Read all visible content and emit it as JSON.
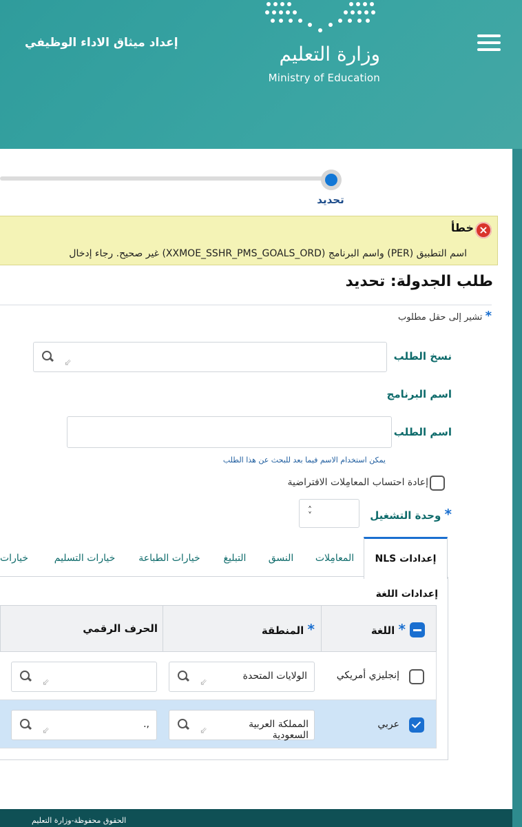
{
  "header": {
    "app_title": "إعداد ميثاق الاداء الوظيفي",
    "logo_arabic": "وزارة التعليم",
    "logo_english": "Ministry of Education",
    "menu_icon": "hamburger-icon"
  },
  "train": {
    "step_label": "تحديد"
  },
  "error": {
    "title": "خطأ",
    "message": "اسم التطبيق (PER) واسم البرنامج (XXMOE_SSHR_PMS_GOALS_ORD) غير صحيح. رجاء إدخال",
    "icon": "error-icon"
  },
  "page": {
    "title": "طلب الجدولة: تحديد",
    "required_note": "تشير إلى حقل مطلوب",
    "required_star": "*"
  },
  "form": {
    "copy_request_label": "نسخ الطلب",
    "program_name_label": "اسم البرنامج",
    "request_name_label": "اسم الطلب",
    "request_name_hint": "يمكن استخدام الاسم فيما بعد للبحث عن هذا الطلب",
    "recalc_label": "إعادة احتساب المعامِلات الافتراضية",
    "operating_unit_label": "وحدة التشغيل"
  },
  "tabs": [
    {
      "label": "إعدادات NLS"
    },
    {
      "label": "المعامِلات"
    },
    {
      "label": "النسق"
    },
    {
      "label": "التبليغ"
    },
    {
      "label": "خيارات الطباعة"
    },
    {
      "label": "خيارات التسليم"
    },
    {
      "label": "خيارات"
    }
  ],
  "language_settings": {
    "section_title": "إعدادات اللغة",
    "columns": {
      "language": "اللغة",
      "territory": "المنطقة",
      "numeric_char": "الحرف الرقمي"
    },
    "rows": [
      {
        "selected": false,
        "language": "إنجليزي أمريكي",
        "territory": "الولايات المتحدة",
        "numeric_char": ""
      },
      {
        "selected": true,
        "language": "عربي",
        "territory": "المملكة العربية السعودية",
        "numeric_char": ",."
      }
    ]
  },
  "footer": {
    "text": "الحقوق محفوظة-وزارة التعليم"
  },
  "colors": {
    "header_teal": "#3aa5a3",
    "accent_blue": "#1a6fd0",
    "error_bg": "#f4f3b6",
    "footer_bg": "#0f5055",
    "label_teal": "#0e6b6b"
  }
}
